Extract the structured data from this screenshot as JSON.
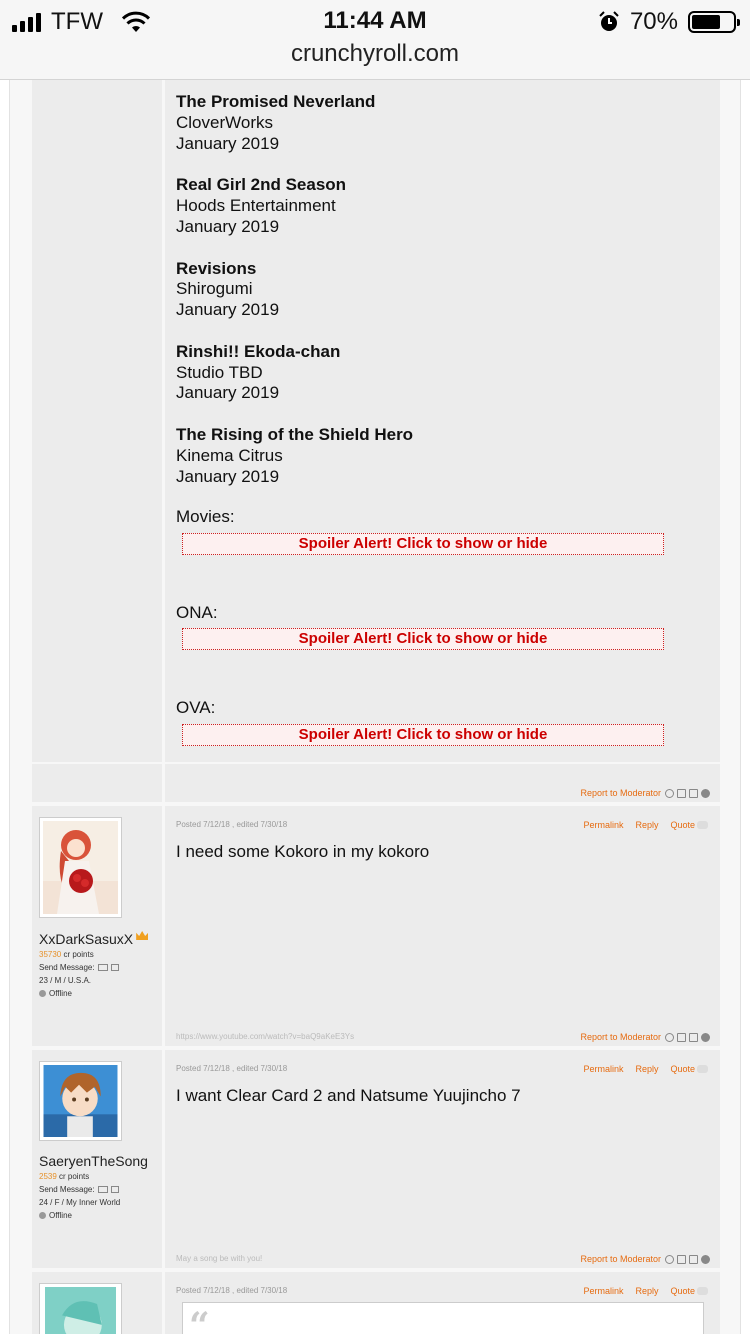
{
  "status": {
    "carrier": "TFW",
    "time": "11:44 AM",
    "url": "crunchyroll.com",
    "battery": "70%",
    "battery_level": 0.7
  },
  "post1": {
    "anime": [
      {
        "title": "The Promised Neverland",
        "studio": "CloverWorks",
        "date": "January 2019"
      },
      {
        "title": "Real Girl 2nd Season",
        "studio": "Hoods Entertainment",
        "date": "January 2019"
      },
      {
        "title": "Revisions",
        "studio": "Shirogumi",
        "date": "January 2019"
      },
      {
        "title": "Rinshi!! Ekoda-chan",
        "studio": "Studio TBD",
        "date": "January 2019"
      },
      {
        "title": "The Rising of the Shield Hero",
        "studio": "Kinema Citrus",
        "date": "January 2019"
      }
    ],
    "movies_label": "Movies:",
    "ona_label": "ONA:",
    "ova_label": "OVA:",
    "spoiler_text": "Spoiler Alert! Click to show or hide",
    "report": "Report to Moderator"
  },
  "post2": {
    "username": "XxDarkSasuxX",
    "points": "35730",
    "points_suffix": " cr points",
    "send_message": "Send Message:",
    "info": "23 / M / U.S.A.",
    "status": "Offline",
    "posted": "Posted 7/12/18 , edited 7/30/18",
    "permalink": "Permalink",
    "reply": "Reply",
    "quote": "Quote",
    "body": "I need some Kokoro in my kokoro",
    "signature": "https://www.youtube.com/watch?v=baQ9aKeE3Ys",
    "report": "Report to Moderator"
  },
  "post3": {
    "username": "SaeryenTheSong",
    "points": "2539",
    "points_suffix": " cr points",
    "send_message": "Send Message:",
    "info": "24 / F / My Inner World",
    "status": "Offline",
    "posted": "Posted 7/12/18 , edited 7/30/18",
    "permalink": "Permalink",
    "reply": "Reply",
    "quote": "Quote",
    "body": "I want Clear Card 2 and Natsume Yuujincho 7",
    "signature": "May a song be with you!",
    "report": "Report to Moderator"
  },
  "post4": {
    "posted": "Posted 7/12/18 , edited 7/30/18",
    "permalink": "Permalink",
    "reply": "Reply",
    "quote": "Quote",
    "quote_mark": "“"
  },
  "colors": {
    "link": "#e66b10",
    "spoiler": "#cc0000",
    "panel": "#ececec"
  }
}
